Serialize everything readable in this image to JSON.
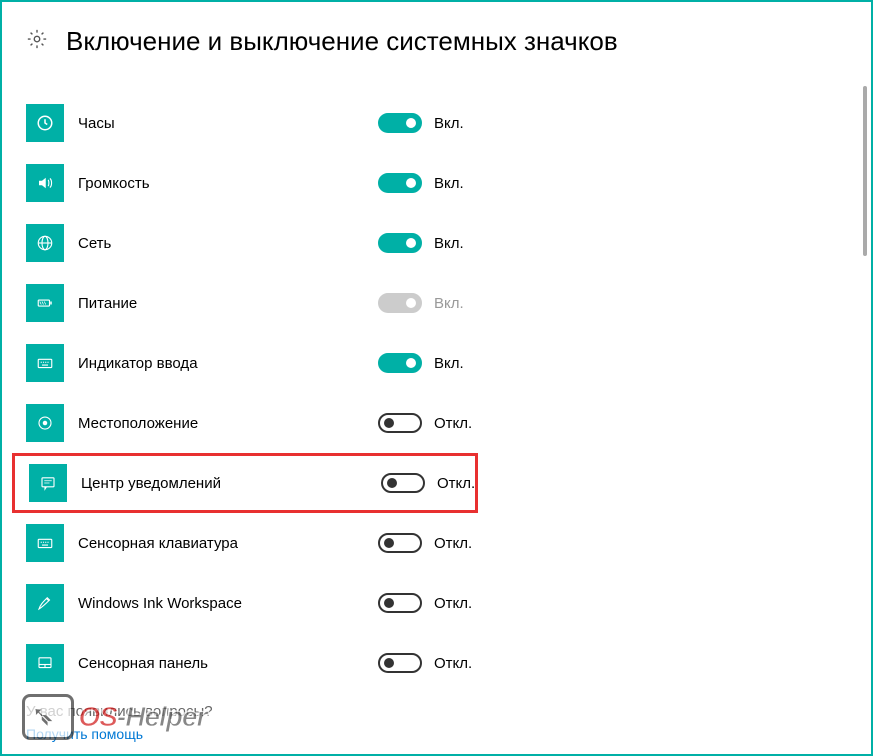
{
  "page": {
    "title": "Включение и выключение системных значков"
  },
  "states": {
    "on": "Вкл.",
    "off": "Откл.",
    "disabled": "Вкл."
  },
  "items": [
    {
      "id": "clock",
      "label": "Часы",
      "state": "on",
      "icon": "clock",
      "highlighted": false
    },
    {
      "id": "volume",
      "label": "Громкость",
      "state": "on",
      "icon": "volume",
      "highlighted": false
    },
    {
      "id": "network",
      "label": "Сеть",
      "state": "on",
      "icon": "globe",
      "highlighted": false
    },
    {
      "id": "power",
      "label": "Питание",
      "state": "disabled",
      "icon": "battery",
      "highlighted": false
    },
    {
      "id": "input-indicator",
      "label": "Индикатор ввода",
      "state": "on",
      "icon": "keyboard",
      "highlighted": false
    },
    {
      "id": "location",
      "label": "Местоположение",
      "state": "off",
      "icon": "target",
      "highlighted": false
    },
    {
      "id": "action-center",
      "label": "Центр уведомлений",
      "state": "off",
      "icon": "message",
      "highlighted": true
    },
    {
      "id": "touch-keyboard",
      "label": "Сенсорная клавиатура",
      "state": "off",
      "icon": "keyboard",
      "highlighted": false
    },
    {
      "id": "ink",
      "label": "Windows Ink Workspace",
      "state": "off",
      "icon": "pen",
      "highlighted": false
    },
    {
      "id": "touchpad",
      "label": "Сенсорная панель",
      "state": "off",
      "icon": "touchpad",
      "highlighted": false
    }
  ],
  "footer": {
    "question": "У вас появились вопросы?",
    "help_link": "Получить помощь"
  },
  "watermark": {
    "os": "OS",
    "helper": "-Helper"
  }
}
